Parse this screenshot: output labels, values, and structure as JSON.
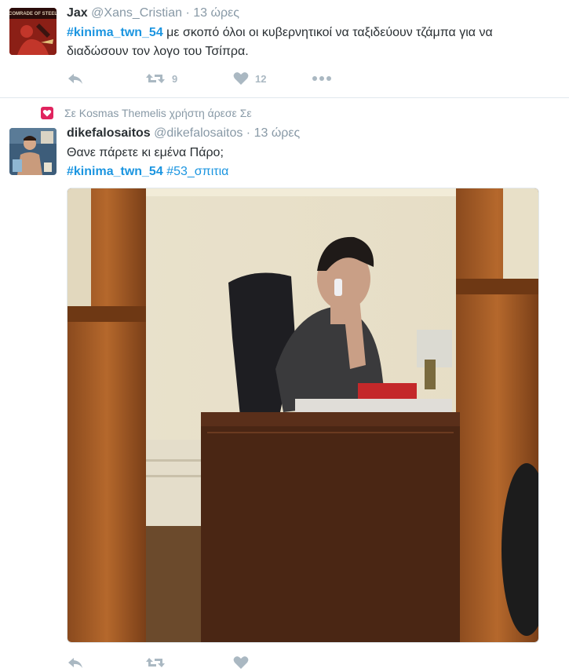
{
  "tweets": [
    {
      "name": "Jax",
      "handle": "@Xans_Cristian",
      "time": "· 13 ώρες",
      "hashtag": "#kinima_twn_54",
      "text": " με σκοπό όλοι οι κυβερνητικοί να ταξιδεύουν τζάμπα για να διαδώσουν τον λογο του Τσίπρα.",
      "avatar_text": [
        "COMRADE OF STEEL"
      ],
      "retweets": "9",
      "likes": "12",
      "icons": [
        "reply-icon",
        "retweet-icon",
        "heart-icon",
        "more-icon"
      ]
    },
    {
      "context": "Σε Kosmas Themelis χρήστη άρεσε Σε",
      "name": "dikefalosaitos",
      "handle": "@dikefalosaitos",
      "time": "· 13 ώρες",
      "line1": "Θανε πάρετε κι εμένα Πάρο;",
      "hashtag1": "#kinima_twn_54",
      "hashtag2": "#53_σπιτια"
    }
  ],
  "colors": {
    "link": "#1b95e0",
    "muted": "#8899a6",
    "icon": "#aab8c2",
    "like_badge": "#e0245e",
    "divider": "#e1e8ed"
  }
}
